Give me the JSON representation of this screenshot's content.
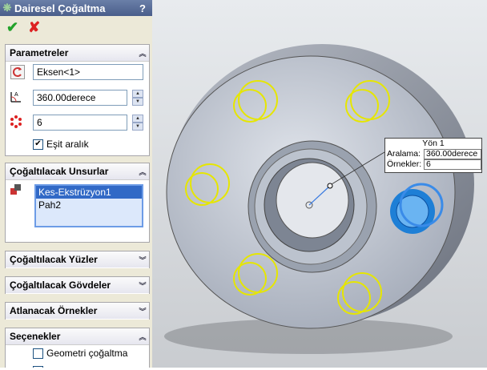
{
  "panel": {
    "title": "Dairesel Çoğaltma",
    "help": "?",
    "ok": "✔",
    "cancel": "✘",
    "parametreler": {
      "header": "Parametreler",
      "axis_value": "Eksen<1>",
      "angle_value": "360.00derece",
      "count_value": "6",
      "equal_spacing_label": "Eşit aralık",
      "equal_spacing_checked": true
    },
    "features": {
      "header": "Çoğaltılacak Unsurlar",
      "items": [
        "Kes-Ekstrüzyon1",
        "Pah2"
      ],
      "selected_index": 0
    },
    "faces_header": "Çoğaltılacak Yüzler",
    "bodies_header": "Çoğaltılacak Gövdeler",
    "skip_header": "Atlanacak Örnekler",
    "options": {
      "header": "Seçenekler",
      "geometry_label": "Geometri çoğaltma",
      "geometry_checked": false
    }
  },
  "callout": {
    "title": "Yön 1",
    "spacing_label": "Aralama:",
    "spacing_value": "360.00derece",
    "instances_label": "Örnekler:",
    "instances_value": "6"
  },
  "colors": {
    "accent": "#3169c6",
    "highlight": "#e6e600",
    "selected_feature": "#1e7fd6"
  }
}
